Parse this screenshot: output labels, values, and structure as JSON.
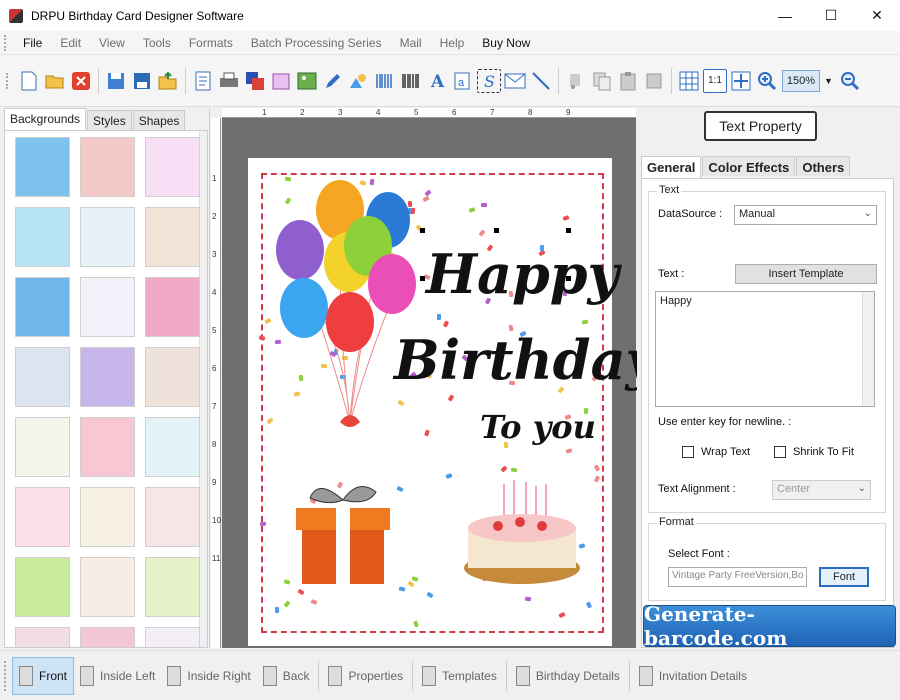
{
  "window": {
    "title": "DRPU Birthday Card Designer Software",
    "controls": {
      "minimize": "—",
      "maximize": "☐",
      "close": "✕"
    }
  },
  "menu": [
    "File",
    "Edit",
    "View",
    "Tools",
    "Formats",
    "Batch Processing Series",
    "Mail",
    "Help",
    "Buy Now"
  ],
  "toolbar": {
    "icons": [
      "new-icon",
      "open-icon",
      "close-doc-icon",
      "save-icon",
      "save-as-icon",
      "export-icon",
      "properties-icon",
      "print-icon",
      "layers-icon",
      "library-icon",
      "image-icon",
      "pencil-icon",
      "shapes-icon",
      "barcode-linear-icon",
      "barcode-icon",
      "text-icon",
      "word-art-icon",
      "signature-icon",
      "email-icon",
      "line-icon",
      "cut-icon",
      "copy-icon",
      "paste-icon",
      "delete-icon",
      "grid-icon",
      "actual-size-icon",
      "fit-icon",
      "zoom-in-icon"
    ],
    "zoom_value": "150%",
    "actual_size_label": "1:1"
  },
  "left_panel": {
    "tabs": [
      "Backgrounds",
      "Styles",
      "Shapes"
    ],
    "active_tab": "Backgrounds",
    "thumbnails": [
      {
        "color": "#7ec3ee"
      },
      {
        "color": "#f6c9c9"
      },
      {
        "color": "#f7e0f5"
      },
      {
        "color": "#b7e3f3"
      },
      {
        "color": "#e6f2f8"
      },
      {
        "color": "#f1e4d6"
      },
      {
        "color": "#6fb6ea"
      },
      {
        "color": "#f2f0f8"
      },
      {
        "color": "#f2a9c8"
      },
      {
        "color": "#dce4ef"
      },
      {
        "color": "#c7b6ea"
      },
      {
        "color": "#efe2db"
      },
      {
        "color": "#f3f6ea"
      },
      {
        "color": "#f7c7d3"
      },
      {
        "color": "#e4f3f8"
      },
      {
        "color": "#fde0ec"
      },
      {
        "color": "#f7f1e4"
      },
      {
        "color": "#f6e6e6"
      },
      {
        "color": "#c8ec9c"
      },
      {
        "color": "#f7ede4"
      },
      {
        "color": "#e6f3c9"
      },
      {
        "color": "#f2dde6"
      },
      {
        "color": "#f5c6d6"
      },
      {
        "color": "#f4eef6"
      }
    ]
  },
  "ruler": {
    "top_numbers": [
      "1",
      "2",
      "3",
      "4",
      "5",
      "6",
      "7",
      "8",
      "9"
    ],
    "left_numbers": [
      "1",
      "2",
      "3",
      "4",
      "5",
      "6",
      "7",
      "8",
      "9",
      "10",
      "11"
    ]
  },
  "card": {
    "line1": "Happy",
    "line2": "Birthday",
    "line3": "To you"
  },
  "right_panel": {
    "header_button": "Text Property",
    "tabs": [
      "General",
      "Color Effects",
      "Others"
    ],
    "active_tab": "General",
    "text_group": {
      "title": "Text",
      "datasource_label": "DataSource :",
      "datasource_value": "Manual",
      "text_label": "Text :",
      "insert_template_button": "Insert Template",
      "text_value": "Happy",
      "newline_hint": "Use enter key for newline. :",
      "wrap_text_label": "Wrap Text",
      "shrink_to_fit_label": "Shrink To Fit",
      "alignment_label": "Text Alignment :",
      "alignment_value": "Center"
    },
    "format_group": {
      "title": "Format",
      "select_font_label": "Select Font :",
      "font_value": "Vintage Party FreeVersion,Bo",
      "font_button": "Font"
    },
    "watermark": "Generate-barcode.com"
  },
  "bottom_bar": [
    {
      "label": "Front",
      "active": true,
      "name": "front"
    },
    {
      "label": "Inside Left",
      "active": false,
      "name": "inside-left"
    },
    {
      "label": "Inside Right",
      "active": false,
      "name": "inside-right"
    },
    {
      "label": "Back",
      "active": false,
      "name": "back"
    },
    {
      "label": "Properties",
      "active": false,
      "name": "properties"
    },
    {
      "label": "Templates",
      "active": false,
      "name": "templates"
    },
    {
      "label": "Birthday Details",
      "active": false,
      "name": "birthday-details"
    },
    {
      "label": "Invitation Details",
      "active": false,
      "name": "invitation-details"
    }
  ],
  "colors": {
    "accent": "#2a6bc4",
    "card_border": "#d23a4a",
    "workspace": "#6f6f6f"
  }
}
